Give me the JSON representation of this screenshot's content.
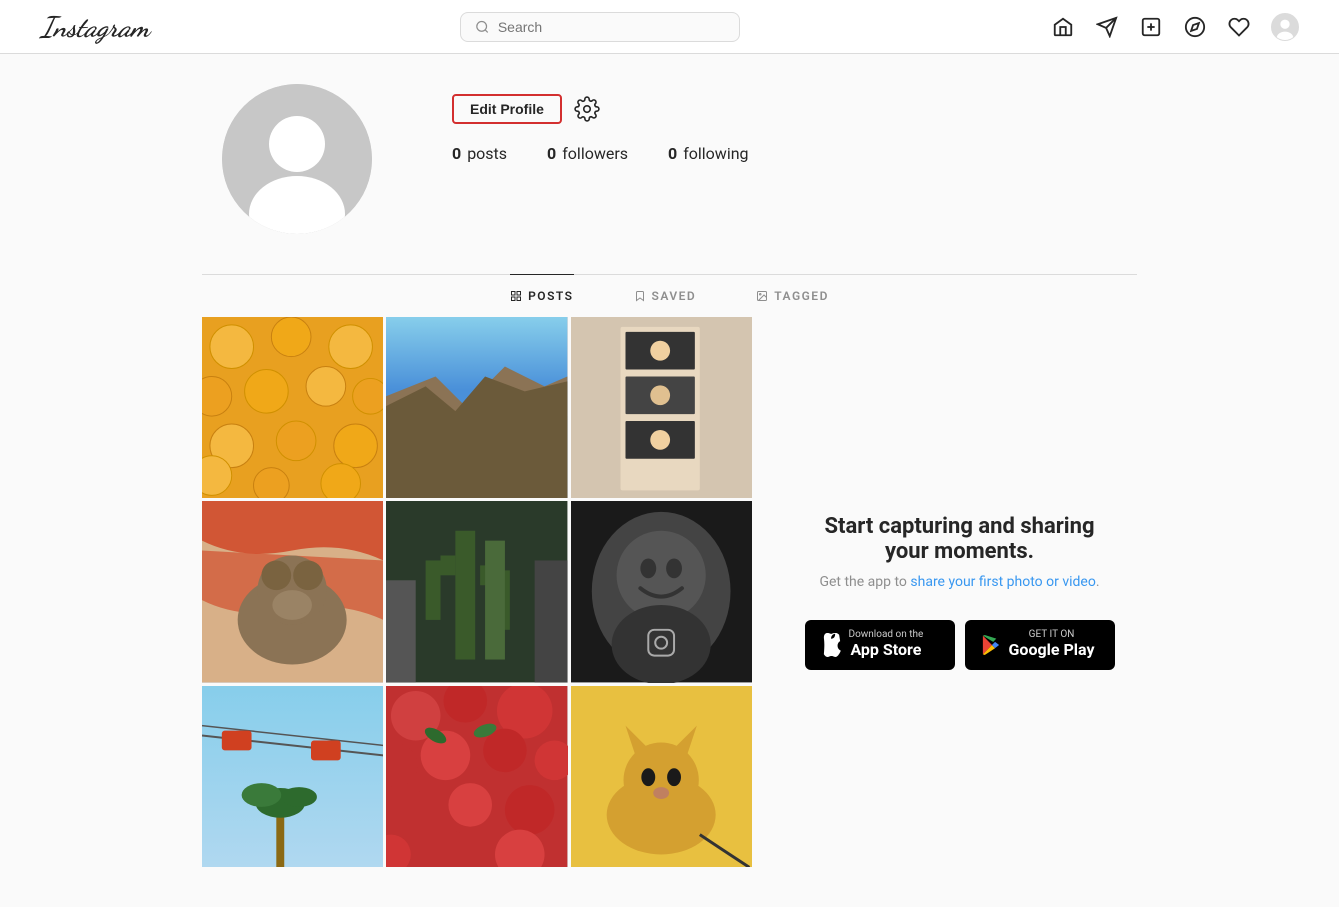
{
  "navbar": {
    "logo": "Instagram",
    "search_placeholder": "Search",
    "icons": [
      "home-icon",
      "send-icon",
      "add-icon",
      "explore-icon",
      "heart-icon",
      "avatar-icon"
    ]
  },
  "profile": {
    "username": "",
    "posts_count": "0",
    "posts_label": "posts",
    "followers_count": "0",
    "followers_label": "followers",
    "following_count": "0",
    "following_label": "following",
    "edit_profile_label": "Edit Profile"
  },
  "tabs": [
    {
      "id": "posts",
      "label": "POSTS",
      "active": true
    },
    {
      "id": "saved",
      "label": "SAVED",
      "active": false
    },
    {
      "id": "tagged",
      "label": "TAGGED",
      "active": false
    }
  ],
  "cta": {
    "title": "Start capturing and sharing your moments.",
    "subtitle_plain": "Get the app to share your first photo or video.",
    "subtitle_link": "share your first photo or video"
  },
  "app_buttons": {
    "apple": {
      "small": "Download on the",
      "large": "App Store"
    },
    "google": {
      "small": "GET IT ON",
      "large": "Google Play"
    }
  },
  "grid_images": [
    {
      "color": "#E8A020",
      "label": "oranges"
    },
    {
      "color": "#4A90D9",
      "label": "ocean"
    },
    {
      "color": "#5A4A3A",
      "label": "photobooth"
    },
    {
      "color": "#C8A080",
      "label": "dog"
    },
    {
      "color": "#4A6A3A",
      "label": "cactus"
    },
    {
      "color": "#2A2A2A",
      "label": "baby"
    },
    {
      "color": "#7AB0D0",
      "label": "cable-car"
    },
    {
      "color": "#C03030",
      "label": "flowers"
    },
    {
      "color": "#E8C040",
      "label": "cat"
    }
  ]
}
